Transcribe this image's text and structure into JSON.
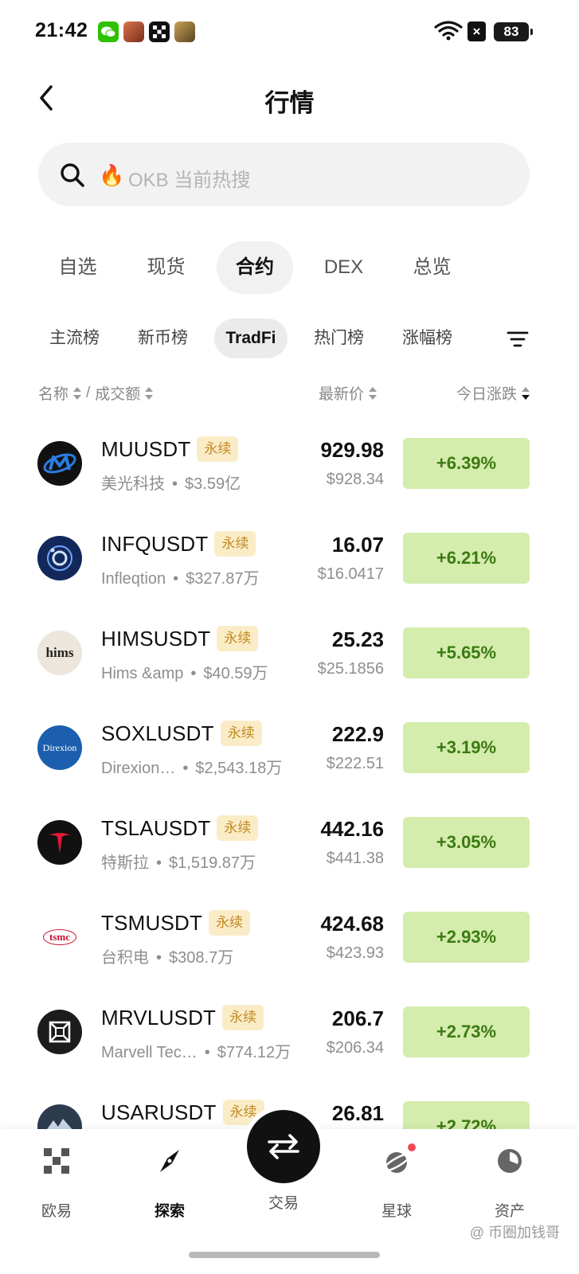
{
  "status_bar": {
    "time": "21:42",
    "battery": "83",
    "app_icons": [
      "wechat-icon",
      "game-icon-1",
      "okx-icon",
      "game-icon-2"
    ]
  },
  "header": {
    "title": "行情"
  },
  "search": {
    "placeholder": "OKB 当前热搜"
  },
  "main_tabs": [
    {
      "label": "自选",
      "active": false
    },
    {
      "label": "现货",
      "active": false
    },
    {
      "label": "合约",
      "active": true
    },
    {
      "label": "DEX",
      "active": false
    },
    {
      "label": "总览",
      "active": false
    }
  ],
  "sub_tabs": [
    {
      "label": "主流榜",
      "active": false
    },
    {
      "label": "新币榜",
      "active": false
    },
    {
      "label": "TradFi",
      "active": true
    },
    {
      "label": "热门榜",
      "active": false
    },
    {
      "label": "涨幅榜",
      "active": false
    }
  ],
  "columns": {
    "name": "名称",
    "volume": "成交额",
    "separator": "/",
    "price": "最新价",
    "change": "今日涨跌"
  },
  "perp_label": "永续",
  "rows": [
    {
      "symbol": "MUUSDT",
      "name": "美光科技",
      "volume": "$3.59亿",
      "price": "929.98",
      "usd": "$928.34",
      "change": "+6.39%",
      "logo": "micron-logo-icon"
    },
    {
      "symbol": "INFQUSDT",
      "name": "Infleqtion",
      "volume": "$327.87万",
      "price": "16.07",
      "usd": "$16.0417",
      "change": "+6.21%",
      "logo": "infleqtion-logo-icon"
    },
    {
      "symbol": "HIMSUSDT",
      "name": "Hims &amp",
      "volume": "$40.59万",
      "price": "25.23",
      "usd": "$25.1856",
      "change": "+5.65%",
      "logo": "hims-logo-icon"
    },
    {
      "symbol": "SOXLUSDT",
      "name": "Direxion…",
      "volume": "$2,543.18万",
      "price": "222.9",
      "usd": "$222.51",
      "change": "+3.19%",
      "logo": "direxion-logo-icon"
    },
    {
      "symbol": "TSLAUSDT",
      "name": "特斯拉",
      "volume": "$1,519.87万",
      "price": "442.16",
      "usd": "$441.38",
      "change": "+3.05%",
      "logo": "tesla-logo-icon"
    },
    {
      "symbol": "TSMUSDT",
      "name": "台积电",
      "volume": "$308.7万",
      "price": "424.68",
      "usd": "$423.93",
      "change": "+2.93%",
      "logo": "tsmc-logo-icon"
    },
    {
      "symbol": "MRVLUSDT",
      "name": "Marvell Tec…",
      "volume": "$774.12万",
      "price": "206.7",
      "usd": "$206.34",
      "change": "+2.73%",
      "logo": "marvell-logo-icon"
    },
    {
      "symbol": "USARUSDT",
      "name": "",
      "volume": "",
      "price": "26.81",
      "usd": "",
      "change": "+2.72%",
      "logo": "usar-logo-icon"
    }
  ],
  "logo_text": {
    "hims": "hims",
    "direxion": "Direxion",
    "tsmc": "tsmc"
  },
  "bottom_nav": [
    {
      "label": "欧易",
      "icon": "okx-grid-icon",
      "active": false
    },
    {
      "label": "探索",
      "icon": "compass-icon",
      "active": true
    },
    {
      "label": "交易",
      "icon": "swap-arrows-icon",
      "active": false
    },
    {
      "label": "星球",
      "icon": "planet-icon",
      "active": false
    },
    {
      "label": "资产",
      "icon": "pie-chart-icon",
      "active": false
    }
  ],
  "watermark": "@ 币圈加钱哥",
  "colors": {
    "up_bg": "#d4ecac",
    "up_text": "#3b7a12",
    "perp_bg": "#fbecc8",
    "perp_text": "#c18a23"
  }
}
